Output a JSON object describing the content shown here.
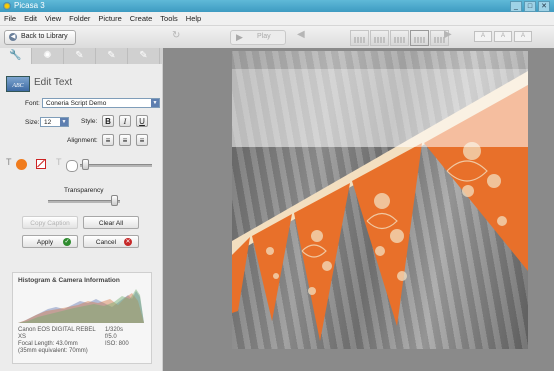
{
  "window": {
    "title": "Picasa 3",
    "controls": [
      "_",
      "□",
      "✕"
    ]
  },
  "menu": [
    "File",
    "Edit",
    "View",
    "Folder",
    "Picture",
    "Create",
    "Tools",
    "Help"
  ],
  "toolbar": {
    "back_label": "Back to Library",
    "play_label": "Play",
    "zoom_buttons": [
      "A",
      "A",
      "A"
    ]
  },
  "tabs": [
    "wrench-icon",
    "sun-icon",
    "brush-icon",
    "brush-plus-icon",
    "brush-sparkle-icon"
  ],
  "panel": {
    "title": "Edit Text",
    "abc_badge": "ABC",
    "font_label": "Font:",
    "font_value": "Coneria Script Demo",
    "size_label": "Size:",
    "size_value": "12",
    "style_label": "Style:",
    "style_buttons": [
      "B",
      "I",
      "U"
    ],
    "alignment_label": "Alignment:",
    "text_color": "#f07c1e",
    "transparency_label": "Transparency",
    "copy_caption_label": "Copy Caption",
    "clear_all_label": "Clear All",
    "apply_label": "Apply",
    "cancel_label": "Cancel"
  },
  "histogram": {
    "title": "Histogram & Camera Information",
    "camera": "Canon EOS DIGITAL REBEL XS",
    "focal_length": "Focal Length: 43.0mm",
    "equiv": "(35mm equivalent:  70mm)",
    "shutter": "1/320s",
    "aperture": "f/5.0",
    "iso": "ISO: 800"
  },
  "colors": {
    "accent_orange": "#f07c1e",
    "pennant_orange": "#e8702a",
    "pennant_cream": "#f3dfc0"
  }
}
